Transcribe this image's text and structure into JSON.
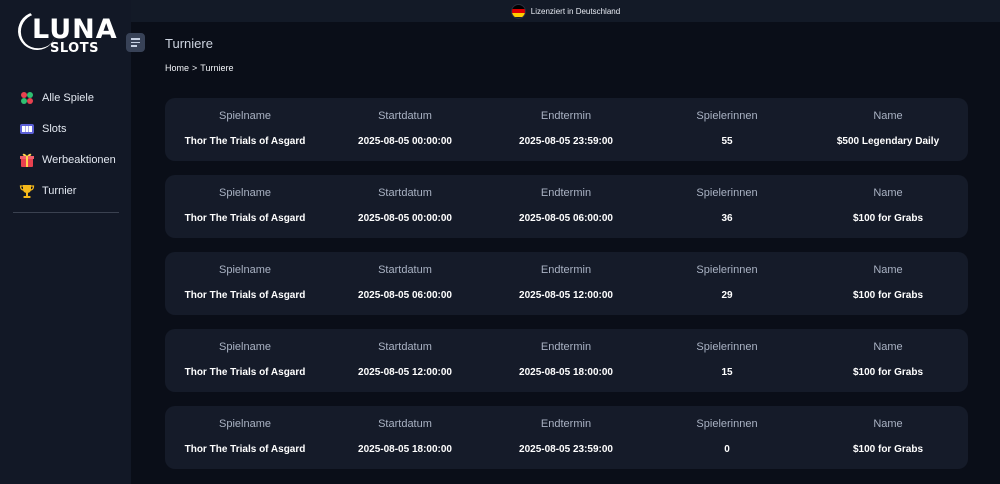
{
  "brand": {
    "name": "LUNA",
    "sub": "SLOTS"
  },
  "topbar": {
    "license_text": "Lizenziert in Deutschland",
    "flag_colors": [
      "#000000",
      "#dd0000",
      "#ffce00"
    ]
  },
  "sidebar": {
    "items": [
      {
        "label": "Alle Spiele",
        "icon": "cards-icon"
      },
      {
        "label": "Slots",
        "icon": "slot-machine-icon"
      },
      {
        "label": "Werbeaktionen",
        "icon": "gift-icon"
      },
      {
        "label": "Turnier",
        "icon": "trophy-icon"
      }
    ]
  },
  "page": {
    "title": "Turniere"
  },
  "breadcrumb": {
    "home": "Home",
    "separator": ">",
    "current": "Turniere"
  },
  "table": {
    "headers": [
      "Spielname",
      "Startdatum",
      "Endtermin",
      "Spielerinnen",
      "Name"
    ],
    "rows": [
      [
        "Thor The Trials of Asgard",
        "2025-08-05 00:00:00",
        "2025-08-05 23:59:00",
        "55",
        "$500 Legendary Daily"
      ],
      [
        "Thor The Trials of Asgard",
        "2025-08-05 00:00:00",
        "2025-08-05 06:00:00",
        "36",
        "$100 for Grabs"
      ],
      [
        "Thor The Trials of Asgard",
        "2025-08-05 06:00:00",
        "2025-08-05 12:00:00",
        "29",
        "$100 for Grabs"
      ],
      [
        "Thor The Trials of Asgard",
        "2025-08-05 12:00:00",
        "2025-08-05 18:00:00",
        "15",
        "$100 for Grabs"
      ],
      [
        "Thor The Trials of Asgard",
        "2025-08-05 18:00:00",
        "2025-08-05 23:59:00",
        "0",
        "$100 for Grabs"
      ]
    ]
  },
  "colors": {
    "background": "#0a0e18",
    "sidebar": "#121826",
    "card": "#151b29",
    "header_text": "#a9b2c3"
  }
}
